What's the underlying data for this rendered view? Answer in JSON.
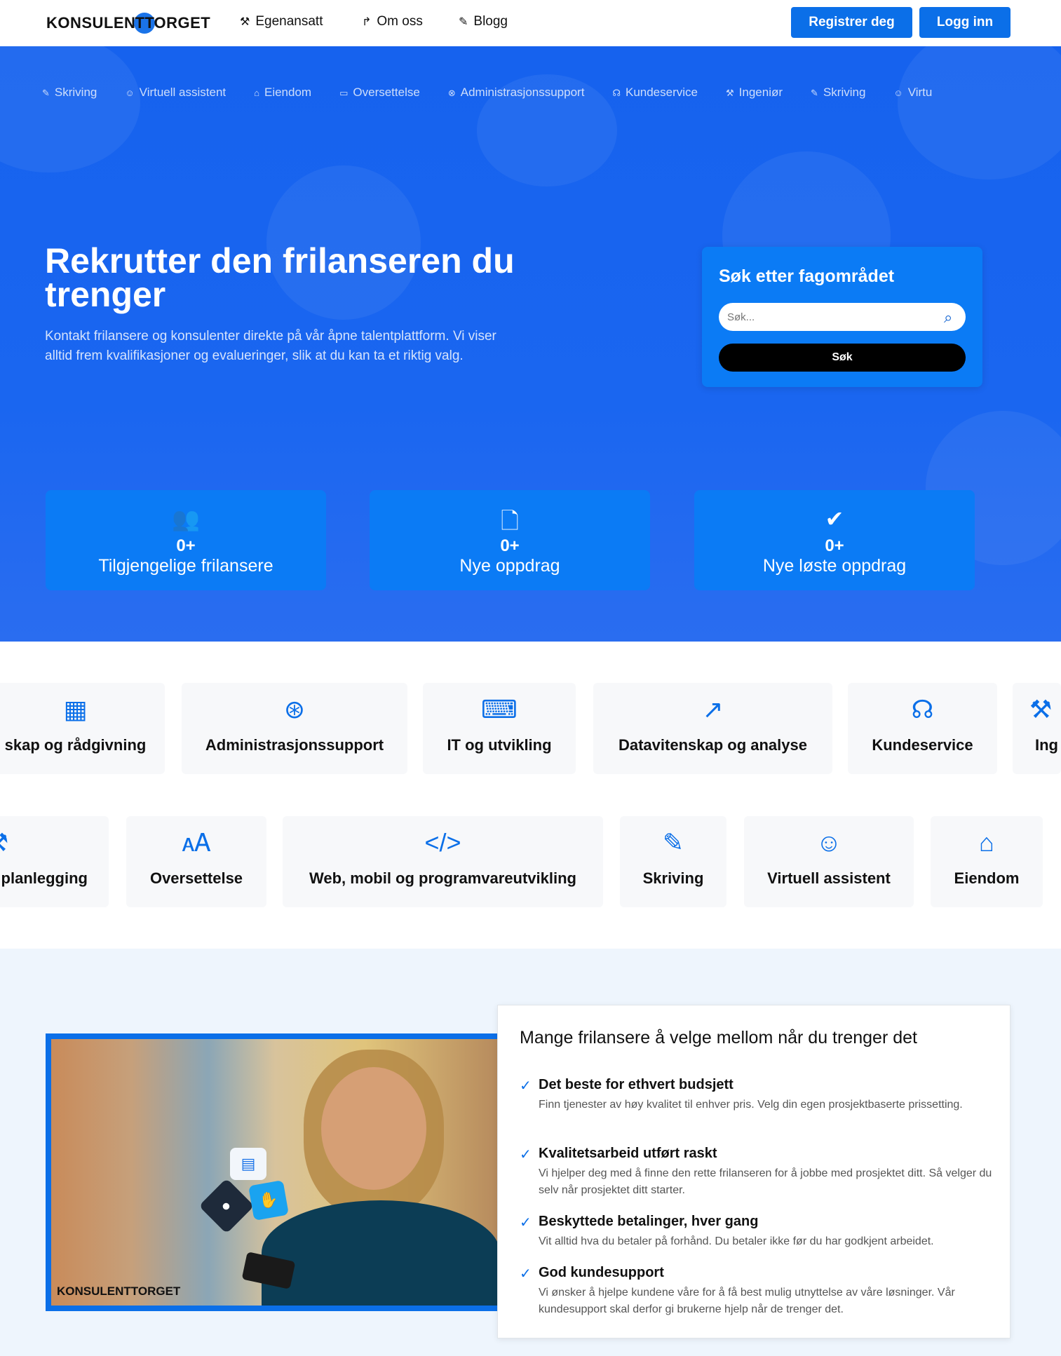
{
  "header": {
    "logo_left": "KONSULEN",
    "logo_mid": "TT",
    "logo_right": "ORGET",
    "nav": [
      {
        "label": "Egenansatt",
        "icon": "person-icon"
      },
      {
        "label": "Om oss",
        "icon": "redirect-icon"
      },
      {
        "label": "Blogg",
        "icon": "blog-icon"
      }
    ],
    "register_label": "Registrer deg",
    "login_label": "Logg inn"
  },
  "hero": {
    "ticker": [
      "Skriving",
      "Virtuell assistent",
      "Eiendom",
      "Oversettelse",
      "Administrasjonssupport",
      "Kundeservice",
      "Ingeniør",
      "Skriving",
      "Virtu"
    ],
    "title": "Rekrutter den frilanseren du trenger",
    "subtitle": "Kontakt frilansere og konsulenter direkte på vår åpne talentplattform. Vi viser alltid frem kvalifikasjoner og evalueringer, slik at du kan ta et riktig valg.",
    "search": {
      "heading": "Søk etter fagområdet",
      "placeholder": "Søk...",
      "button": "Søk"
    },
    "stats": [
      {
        "value": "0+",
        "label": "Tilgjengelige frilansere",
        "icon": "users-icon"
      },
      {
        "value": "0+",
        "label": "Nye oppdrag",
        "icon": "file-plus-icon"
      },
      {
        "value": "0+",
        "label": "Nye løste oppdrag",
        "icon": "check-circle-icon"
      }
    ]
  },
  "categories": {
    "row1": [
      {
        "label": "skap og rådgivning",
        "icon": "calculator-icon"
      },
      {
        "label": "Administrasjonssupport",
        "icon": "lifebuoy-icon"
      },
      {
        "label": "IT og utvikling",
        "icon": "laptop-code-icon"
      },
      {
        "label": "Datavitenskap og analyse",
        "icon": "chart-line-icon"
      },
      {
        "label": "Kundeservice",
        "icon": "headset-icon"
      },
      {
        "label": "Ing",
        "icon": "wrench-icon"
      }
    ],
    "row2": [
      {
        "label": "planlegging",
        "icon": "tools-icon"
      },
      {
        "label": "Oversettelse",
        "icon": "translate-icon"
      },
      {
        "label": "Web, mobil og programvareutvikling",
        "icon": "code-icon"
      },
      {
        "label": "Skriving",
        "icon": "pencil-icon"
      },
      {
        "label": "Virtuell assistent",
        "icon": "user-gear-icon"
      },
      {
        "label": "Eiendom",
        "icon": "house-icon"
      }
    ]
  },
  "feature": {
    "image_logo": "KONSULENTTORGET",
    "heading": "Mange frilansere å velge mellom når du trenger det",
    "items": [
      {
        "title": "Det beste for ethvert budsjett",
        "desc": "Finn tjenester av høy kvalitet til enhver pris. Velg din egen prosjektbaserte prissetting."
      },
      {
        "title": "Kvalitetsarbeid utført raskt",
        "desc": "Vi hjelper deg med å finne den rette frilanseren for å jobbe med prosjektet ditt. Så velger du selv når prosjektet ditt starter."
      },
      {
        "title": "Beskyttede betalinger, hver gang",
        "desc": "Vit alltid hva du betaler på forhånd. Du betaler ikke før du har godkjent arbeidet."
      },
      {
        "title": "God kundesupport",
        "desc": "Vi ønsker å hjelpe kundene våre for å få best mulig utnyttelse av våre løsninger. Vår kundesupport skal derfor gi brukerne hjelp når de trenger det."
      }
    ]
  },
  "colors": {
    "brand": "#0b6fe8",
    "hero_bg": "#1662ee",
    "card_blue": "#0b7bf5",
    "feature_bg": "#eef5fd"
  }
}
